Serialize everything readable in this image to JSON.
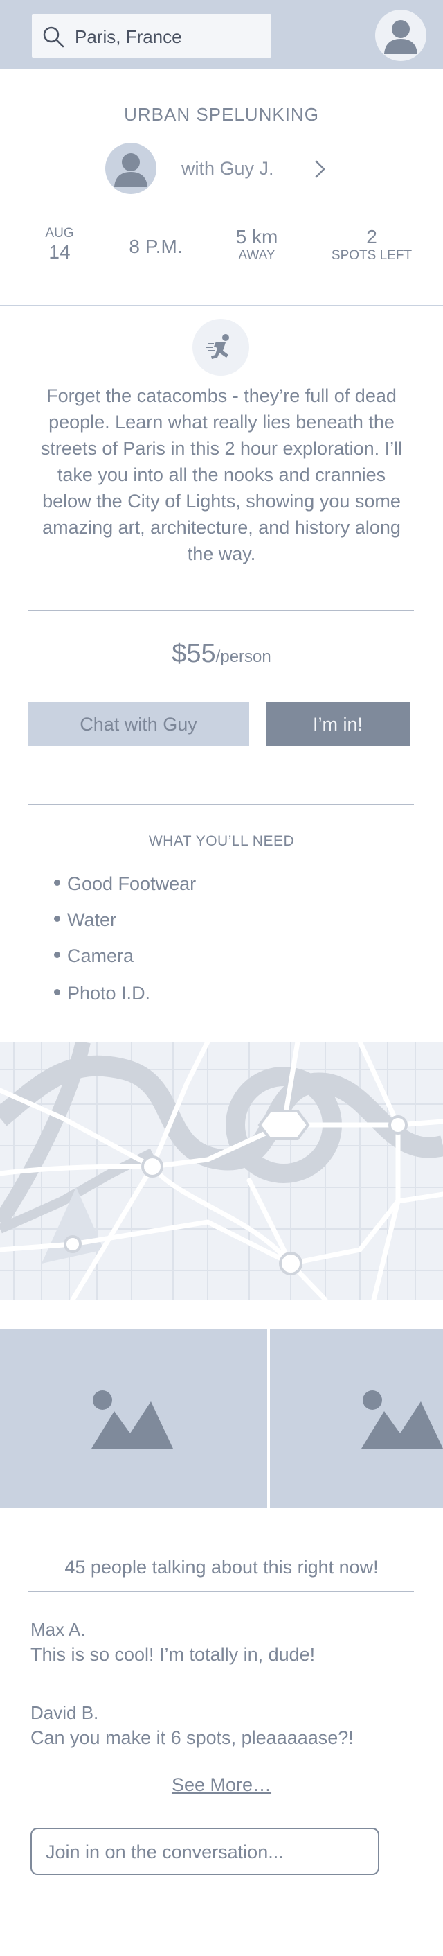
{
  "search": {
    "value": "Paris, France",
    "icon": "search-icon"
  },
  "colors": {
    "header_bg": "#c9d2e0",
    "accent_button": "#7f8a9b",
    "text": "#7d8798"
  },
  "event": {
    "title": "URBAN SPELUNKING",
    "host": "with Guy J.",
    "date_month": "AUG",
    "date_day": "14",
    "time": "8 P.M.",
    "distance_value": "5 km",
    "distance_label": "AWAY",
    "spots_value": "2",
    "spots_label": "SPOTS LEFT",
    "description": "Forget the catacombs - they’re full of dead people. Learn what really lies beneath the streets of Paris in this 2 hour exploration. I’ll take you into all the nooks and crannies below the City of Lights, showing you some amazing art, architecture, and history along the way.",
    "price_amount": "$55",
    "price_unit": "/person"
  },
  "actions": {
    "chat_label": "Chat with Guy",
    "join_label": "I’m in!"
  },
  "needs": {
    "title": "WHAT YOU’LL NEED",
    "items": [
      "Good Footwear",
      "Water",
      "Camera",
      "Photo I.D."
    ]
  },
  "discussion": {
    "header": "45 people talking about this right now!",
    "comments": [
      {
        "name": "Max A.",
        "text": "This is so cool! I’m totally in, dude!"
      },
      {
        "name": "David B.",
        "text": "Can you make it 6 spots, pleaaaaase?!"
      }
    ],
    "see_more": "See More…",
    "input_placeholder": "Join in on the conversation..."
  }
}
